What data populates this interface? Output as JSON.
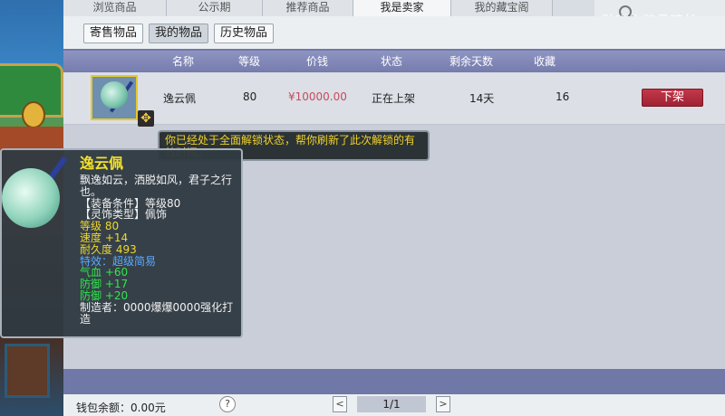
{
  "top_tabs": [
    "浏览商品",
    "公示期",
    "推荐商品",
    "我是卖家",
    "我的藏宝阁"
  ],
  "top_tab_active": 3,
  "watermark": "贴吧小装品暗长",
  "sub_tabs": [
    "寄售物品",
    "我的物品",
    "历史物品"
  ],
  "sub_tab_active": 1,
  "table": {
    "headers": [
      "名称",
      "等级",
      "价钱",
      "状态",
      "剩余天数",
      "收藏"
    ],
    "row": {
      "name": "逸云佩",
      "level": "80",
      "price": "¥10000.00",
      "status": "正在上架",
      "days": "14天",
      "favorites": "16",
      "action_label": "下架"
    }
  },
  "lock_tooltip": "你已经处于全面解锁状态，帮你刷新了此次解锁的有效时间。",
  "item_tooltip": {
    "name": "逸云佩",
    "desc": "飘逸如云，洒脱如风，君子之行也。",
    "req": "【装备条件】等级80",
    "type": "【灵饰类型】佩饰",
    "level": "等级 80",
    "speed": "速度 +14",
    "durability": "耐久度 493",
    "special": "特效：超级简易",
    "hp": "气血 +60",
    "def1": "防御 +17",
    "def2": "防御 +20",
    "maker": "制造者：0000爆爆0000强化打造"
  },
  "footer": {
    "wallet": "钱包余额：0.00元",
    "help": "?",
    "prev": "<",
    "page": "1/1",
    "next": ">"
  },
  "colors": {
    "header_bg": "#7d83b3",
    "price": "#c64c5a",
    "unlist_button": "#b22c3d",
    "tooltip_title": "#f2e02a"
  }
}
